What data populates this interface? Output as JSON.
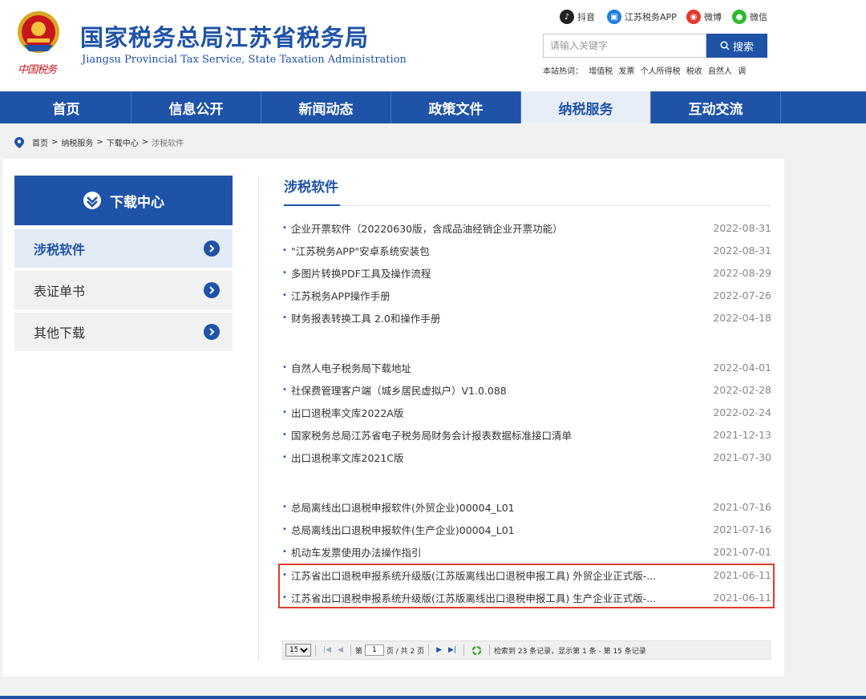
{
  "header": {
    "title": "国家税务总局江苏省税务局",
    "subtitle": "Jiangsu Provincial Tax Service, State Taxation Administration",
    "seal_text": "中国税务",
    "social": [
      {
        "label": "抖音",
        "icon": "douyin-icon",
        "color": "#222222"
      },
      {
        "label": "江苏税务APP",
        "icon": "app-icon",
        "color": "#1f7de0"
      },
      {
        "label": "微博",
        "icon": "weibo-icon",
        "color": "#e6372b"
      },
      {
        "label": "微信",
        "icon": "wechat-icon",
        "color": "#2dbb2d"
      }
    ],
    "search": {
      "placeholder": "请输入关键字",
      "button_label": "搜索"
    },
    "hot_words_label": "本站热词：",
    "hot_words": [
      "增值税",
      "发票",
      "个人所得税",
      "税收",
      "自然人",
      "调"
    ]
  },
  "nav": {
    "items": [
      "首页",
      "信息公开",
      "新闻动态",
      "政策文件",
      "纳税服务",
      "互动交流"
    ],
    "active": "纳税服务"
  },
  "breadcrumb": {
    "items": [
      "首页",
      "纳税服务",
      "下载中心",
      "涉税软件"
    ],
    "separator": ">"
  },
  "sidebar": {
    "title": "下载中心",
    "items": [
      {
        "label": "涉税软件",
        "active": true
      },
      {
        "label": "表证单书",
        "active": false
      },
      {
        "label": "其他下载",
        "active": false
      }
    ]
  },
  "main": {
    "section_title": "涉税软件",
    "items": [
      {
        "title": "企业开票软件（20220630版，含成品油经销企业开票功能）",
        "date": "2022-08-31"
      },
      {
        "title": "\"江苏税务APP\"安卓系统安装包",
        "date": "2022-08-31"
      },
      {
        "title": "多图片转换PDF工具及操作流程",
        "date": "2022-08-29"
      },
      {
        "title": "江苏税务APP操作手册",
        "date": "2022-07-26"
      },
      {
        "title": "财务报表转换工具 2.0和操作手册",
        "date": "2022-04-18"
      },
      {
        "title": "自然人电子税务局下载地址",
        "date": "2022-04-01"
      },
      {
        "title": "社保费管理客户端（城乡居民虚拟户）V1.0.088",
        "date": "2022-02-28"
      },
      {
        "title": "出口退税率文库2022A版",
        "date": "2022-02-24"
      },
      {
        "title": "国家税务总局江苏省电子税务局财务会计报表数据标准接口清单",
        "date": "2021-12-13"
      },
      {
        "title": "出口退税率文库2021C版",
        "date": "2021-07-30"
      },
      {
        "title": "总局离线出口退税申报软件(外贸企业)00004_L01",
        "date": "2021-07-16"
      },
      {
        "title": "总局离线出口退税申报软件(生产企业)00004_L01",
        "date": "2021-07-16"
      },
      {
        "title": "机动车发票使用办法操作指引",
        "date": "2021-07-01"
      },
      {
        "title": "江苏省出口退税申报系统升级版(江苏版离线出口退税申报工具) 外贸企业正式版-...",
        "date": "2021-06-11"
      },
      {
        "title": "江苏省出口退税申报系统升级版(江苏版离线出口退税申报工具) 生产企业正式版-...",
        "date": "2021-06-11"
      }
    ]
  },
  "pager": {
    "page_size": "15",
    "page_label_before": "第",
    "current_page": "1",
    "page_label_after": "页 / 共 2 页",
    "summary": "检索到 23 条记录，显示第 1 条 - 第 15 条记录"
  }
}
